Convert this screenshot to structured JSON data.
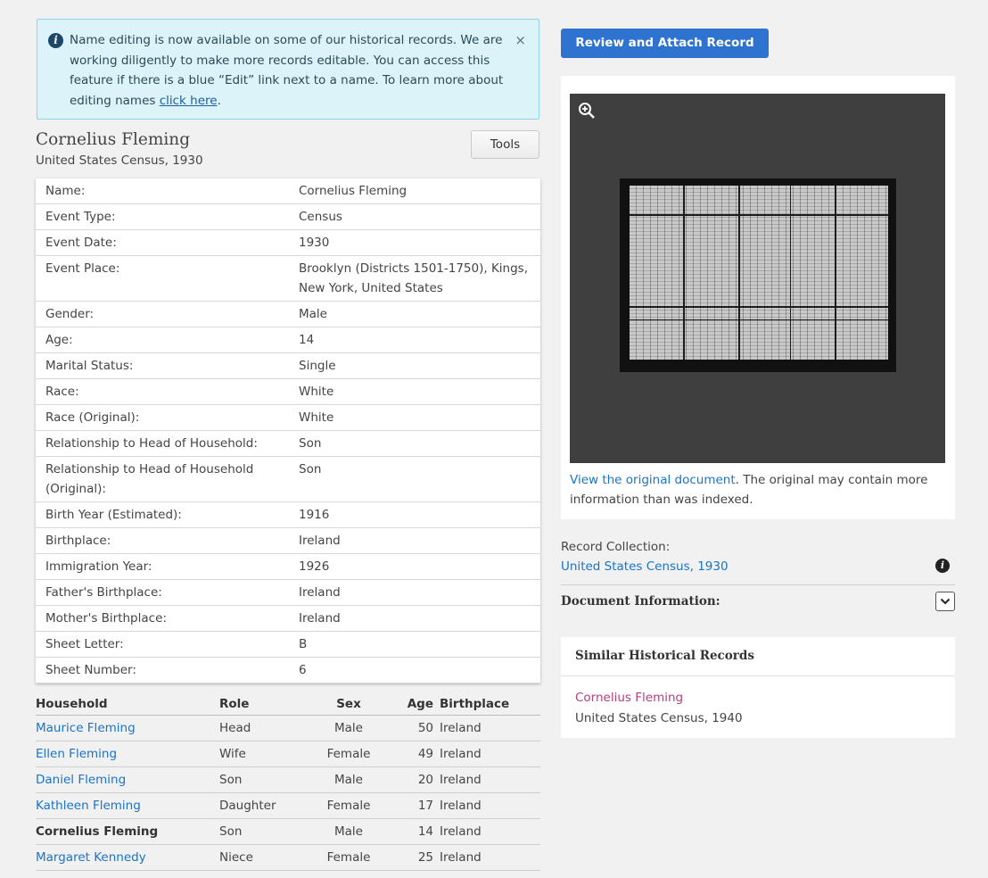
{
  "notice": {
    "text_main": "Name editing is now available on some of our historical records. We are working diligently to make more records editable. You can access this feature if there is a blue “Edit” link next to a name. To learn more about editing names ",
    "link_text": "click here",
    "text_end": ".",
    "close_label": "×",
    "icon": "info-icon"
  },
  "record": {
    "name": "Cornelius Fleming",
    "collection": "United States Census, 1930",
    "tools_label": "Tools"
  },
  "details": [
    {
      "label": "Name:",
      "value": "Cornelius Fleming"
    },
    {
      "label": "Event Type:",
      "value": "Census"
    },
    {
      "label": "Event Date:",
      "value": "1930"
    },
    {
      "label": "Event Place:",
      "value": "Brooklyn (Districts 1501-1750), Kings, New York, United States"
    },
    {
      "label": "Gender:",
      "value": "Male"
    },
    {
      "label": "Age:",
      "value": "14"
    },
    {
      "label": "Marital Status:",
      "value": "Single"
    },
    {
      "label": "Race:",
      "value": "White"
    },
    {
      "label": "Race (Original):",
      "value": "White"
    },
    {
      "label": "Relationship to Head of Household:",
      "value": "Son"
    },
    {
      "label": "Relationship to Head of Household (Original):",
      "value": "Son"
    },
    {
      "label": "Birth Year (Estimated):",
      "value": "1916"
    },
    {
      "label": "Birthplace:",
      "value": "Ireland"
    },
    {
      "label": "Immigration Year:",
      "value": "1926"
    },
    {
      "label": "Father's Birthplace:",
      "value": "Ireland"
    },
    {
      "label": "Mother's Birthplace:",
      "value": "Ireland"
    },
    {
      "label": "Sheet Letter:",
      "value": "B"
    },
    {
      "label": "Sheet Number:",
      "value": "6"
    }
  ],
  "household": {
    "headers": [
      "Household",
      "Role",
      "Sex",
      "Age",
      "Birthplace"
    ],
    "rows": [
      {
        "name": "Maurice Fleming",
        "role": "Head",
        "sex": "Male",
        "age": "50",
        "birthplace": "Ireland"
      },
      {
        "name": "Ellen Fleming",
        "role": "Wife",
        "sex": "Female",
        "age": "49",
        "birthplace": "Ireland"
      },
      {
        "name": "Daniel Fleming",
        "role": "Son",
        "sex": "Male",
        "age": "20",
        "birthplace": "Ireland"
      },
      {
        "name": "Kathleen Fleming",
        "role": "Daughter",
        "sex": "Female",
        "age": "17",
        "birthplace": "Ireland"
      },
      {
        "name": "Cornelius Fleming",
        "role": "Son",
        "sex": "Male",
        "age": "14",
        "birthplace": "Ireland"
      },
      {
        "name": "Margaret Kennedy",
        "role": "Niece",
        "sex": "Female",
        "age": "25",
        "birthplace": "Ireland"
      }
    ],
    "current_row_index": 4
  },
  "actions": {
    "review_attach_label": "Review and Attach Record"
  },
  "image_panel": {
    "zoom_icon": "zoom-in-icon",
    "view_link": "View the original document",
    "caption_rest": ". The original may contain more information than was indexed."
  },
  "sidebar": {
    "record_collection_label": "Record Collection:",
    "record_collection_link": "United States Census, 1930",
    "document_information_label": "Document Information:",
    "similar_title": "Similar Historical Records",
    "similar_items": [
      {
        "name": "Cornelius Fleming",
        "collection": "United States Census, 1940"
      }
    ]
  },
  "colors": {
    "link": "#1a73c9",
    "primary_button": "#2f73d1",
    "notice_bg": "#dcf3fa",
    "similar_link": "#b83e7a"
  }
}
